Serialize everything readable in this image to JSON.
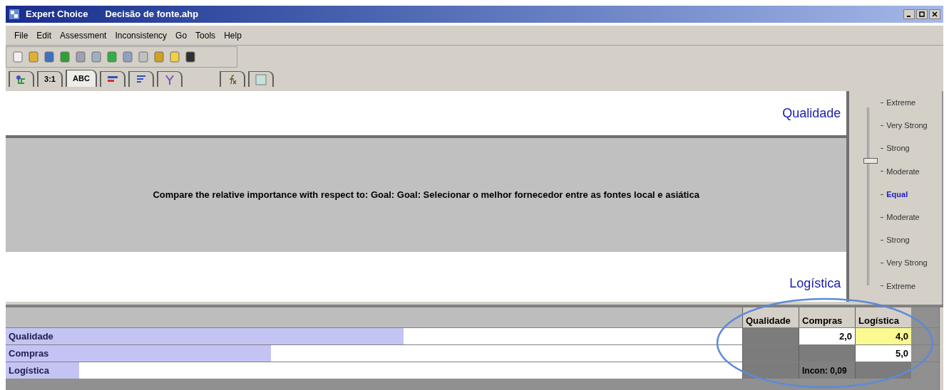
{
  "window": {
    "title": "Expert Choice",
    "document": "Decisão de fonte.ahp"
  },
  "menu": [
    "File",
    "Edit",
    "Assessment",
    "Inconsistency",
    "Go",
    "Tools",
    "Help"
  ],
  "tabs": [
    {
      "kind": "tree",
      "selected": false
    },
    {
      "kind": "text",
      "label": "3:1",
      "selected": false
    },
    {
      "kind": "text",
      "label": "ABC",
      "selected": true
    },
    {
      "kind": "bars",
      "selected": false
    },
    {
      "kind": "lines",
      "selected": false
    },
    {
      "kind": "network",
      "selected": false
    },
    {
      "kind": "formula",
      "selected": false
    },
    {
      "kind": "sheet",
      "selected": false
    }
  ],
  "comparison": {
    "top": "Qualidade",
    "prompt": "Compare the relative importance with respect to: Goal: Goal: Selecionar o melhor fornecedor entre as fontes local e asiática",
    "bottom": "Logística"
  },
  "scale": {
    "level": 0.7,
    "labels": [
      {
        "text": "Extreme",
        "selected": false
      },
      {
        "text": "Very Strong",
        "selected": false
      },
      {
        "text": "Strong",
        "selected": false
      },
      {
        "text": "Moderate",
        "selected": false
      },
      {
        "text": "Equal",
        "selected": true
      },
      {
        "text": "Moderate",
        "selected": false
      },
      {
        "text": "Strong",
        "selected": false
      },
      {
        "text": "Very Strong",
        "selected": false
      },
      {
        "text": "Extreme",
        "selected": false
      }
    ]
  },
  "matrix": {
    "columns": [
      "Qualidade",
      "Compras",
      "Logística"
    ],
    "rows": [
      {
        "name": "Qualidade",
        "level": 0.54,
        "cells": [
          {
            "kind": "blank"
          },
          {
            "kind": "value",
            "text": "2,0",
            "highlighted": false
          },
          {
            "kind": "value",
            "text": "4,0",
            "highlighted": true
          }
        ]
      },
      {
        "name": "Compras",
        "level": 0.36,
        "cells": [
          {
            "kind": "blank"
          },
          {
            "kind": "blank"
          },
          {
            "kind": "value",
            "text": "5,0",
            "highlighted": false
          }
        ]
      },
      {
        "name": "Logística",
        "level": 0.1,
        "cells": [
          {
            "kind": "blank"
          },
          {
            "kind": "note",
            "text": "Incon: 0,09"
          },
          {
            "kind": "blank"
          }
        ]
      }
    ]
  }
}
